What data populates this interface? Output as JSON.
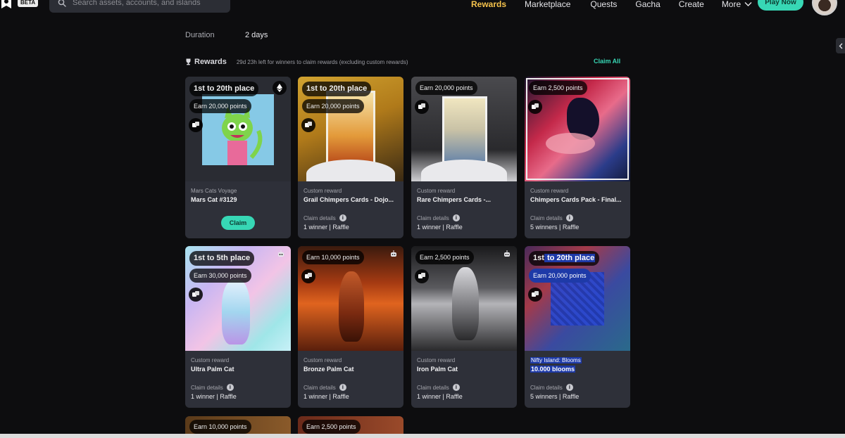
{
  "nav": {
    "beta_label": "BETA",
    "search_placeholder": "Search assets, accounts, and islands",
    "links": [
      "Rewards",
      "Marketplace",
      "Quests",
      "Gacha",
      "Create",
      "More"
    ],
    "play_now": "Play Now",
    "accent_color": "#f5c24c",
    "cta_color": "#37d7b5"
  },
  "duration": {
    "label": "Duration",
    "value": "2 days"
  },
  "rewards": {
    "title": "Rewards",
    "note": "29d 23h left for winners to claim rewards (excluding custom rewards)",
    "claim_all": "Claim All"
  },
  "cards": [
    {
      "place": "1st to 20th place",
      "points": "Earn 20,000 points",
      "kicker": "Mars Cats Voyage",
      "name": "Mars Cat #3129",
      "claim": "Claim"
    },
    {
      "place": "1st to 20th place",
      "points": "Earn 20,000 points",
      "kicker": "Custom reward",
      "name": "Grail Chimpers Cards - Dojo...",
      "details": "Claim details",
      "winners": "1 winner | Raffle"
    },
    {
      "points": "Earn 20,000 points",
      "kicker": "Custom reward",
      "name": "Rare Chimpers Cards -...",
      "details": "Claim details",
      "winners": "1 winner | Raffle"
    },
    {
      "points": "Earn 2,500 points",
      "kicker": "Custom reward",
      "name": "Chimpers Cards Pack - Final...",
      "details": "Claim details",
      "winners": "5 winners | Raffle"
    },
    {
      "place": "1st to 5th place",
      "points": "Earn 30,000 points",
      "kicker": "Custom reward",
      "name": "Ultra Palm Cat",
      "details": "Claim details",
      "winners": "1 winner | Raffle"
    },
    {
      "points": "Earn 10,000 points",
      "kicker": "Custom reward",
      "name": "Bronze Palm Cat",
      "details": "Claim details",
      "winners": "1 winner | Raffle"
    },
    {
      "points": "Earn 2,500 points",
      "kicker": "Custom reward",
      "name": "Iron Palm Cat",
      "details": "Claim details",
      "winners": "1 winner | Raffle"
    },
    {
      "place_prefix": "1st",
      "place_suffix": " to 20th place",
      "points": "Earn 20,000 points",
      "kicker": "Nifty Island: Blooms",
      "name": "10.000 blooms",
      "details": "Claim details",
      "winners": "5 winners | Raffle"
    },
    {
      "points": "Earn 10,000 points"
    },
    {
      "points": "Earn 2,500 points"
    }
  ]
}
